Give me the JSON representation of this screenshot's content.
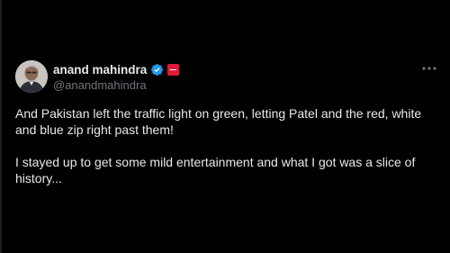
{
  "author": {
    "display_name": "anand mahindra",
    "handle": "@anandmahindra",
    "verified_icon": "verified-badge-icon",
    "affiliate_icon": "mahindra-logo-badge-icon"
  },
  "menu": {
    "icon": "more-horizontal-icon"
  },
  "tweet": {
    "paragraph_1": "And Pakistan left the traffic light on green, letting Patel and the red, white and blue zip right past them!",
    "paragraph_2": "I stayed up to get some mild entertainment and what I got was a slice of history..."
  },
  "colors": {
    "background": "#000000",
    "text_primary": "#e7e9ea",
    "text_secondary": "#71767b",
    "verified_blue": "#1d9bf0",
    "affiliate_red": "#e31837"
  }
}
